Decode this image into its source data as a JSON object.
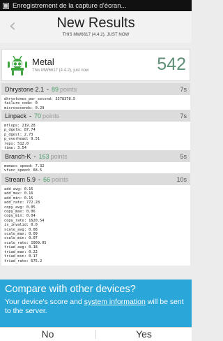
{
  "status_bar": {
    "notification_text": "Enregistrement de la capture d'écran..."
  },
  "header": {
    "title": "New Results",
    "subtitle": "THIS MW6617 (4.4.2), JUST NOW"
  },
  "device": {
    "name": "Metal",
    "subtitle": "This MW6617 (4.4.2), just now",
    "score": "542"
  },
  "sections": [
    {
      "name": "Dhrystone 2.1",
      "points": "89",
      "points_label": "points",
      "time": "7s",
      "lines": [
        "dhrystones_per_second: 3378378.5",
        "failure_code: 0",
        "microseconds: 0.29"
      ]
    },
    {
      "name": "Linpack",
      "points": "70",
      "points_label": "points",
      "time": "7s",
      "lines": [
        "mflops: 219.28",
        "p_dgefa: 87.74",
        "p_dgesl: 2.73",
        "p_overhead: 9.51",
        "reps: 512.0",
        "time: 3.54"
      ]
    },
    {
      "name": "Branch-K",
      "points": "163",
      "points_label": "points",
      "time": "5s",
      "lines": [
        "memacc_speed: 7.32",
        "vfunc_speed: 68.5"
      ]
    },
    {
      "name": "Stream 5.9",
      "points": "66",
      "points_label": "points",
      "time": "10s",
      "lines": [
        "add_avg: 0.15",
        "add_max: 0.16",
        "add_min: 0.15",
        "add_rate: 772.28",
        "copy_avg: 0.05",
        "copy_max: 0.06",
        "copy_min: 0.04",
        "copy_rate: 1620.54",
        "is_invalid: 0.0",
        "scale_avg: 0.08",
        "scale_max: 0.09",
        "scale_min: 0.07",
        "scale_rate: 1009.05",
        "triad_avg: 0.18",
        "triad_max: 0.22",
        "triad_min: 0.17",
        "triad_rate: 675.2"
      ]
    }
  ],
  "compare": {
    "question": "Compare with other devices?",
    "msg_before": "Your device's score and ",
    "msg_link": "system information",
    "msg_after": " will be sent to the server."
  },
  "buttons": {
    "no": "No",
    "yes": "Yes"
  },
  "colors": {
    "accent": "#2aa6d9",
    "score": "#5f8f77",
    "points": "#4c9a68"
  },
  "icons": {
    "back": "chevron-left-icon",
    "logo": "android-logo-icon"
  }
}
